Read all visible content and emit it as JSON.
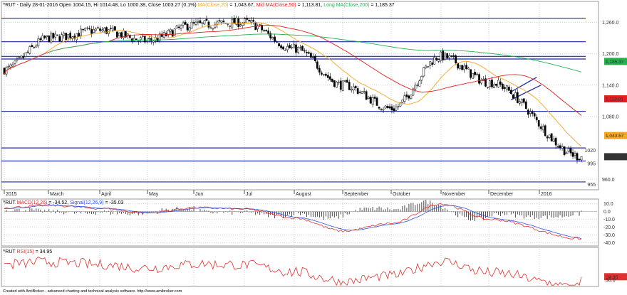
{
  "header": {
    "symbol": "^RUT",
    "info": "- Daily 28-01-2016 Open 1004.15, Hi 1014.48, Lo 1000.38, Close 1003.27 (0.1%)",
    "ma20_label": "MA(Close,20)",
    "ma20_value": "= 1,043.67,",
    "ma50_label": "Mid MA(Close,50)",
    "ma50_value": "= 1,113.81,",
    "ma200_label": "Long MA(Close,200)",
    "ma200_value": "= 1,185.37"
  },
  "macd_header": {
    "symbol": "^RUT",
    "macd_label": "MACD(12,26)",
    "macd_value": "= -34.52,",
    "signal_label": "Signal(12,26,9)",
    "signal_value": "= -35.03"
  },
  "rsi_header": {
    "symbol": "^RUT",
    "rsi_label": "RSI(15)",
    "rsi_value": "= 34.95"
  },
  "footer": "Created with AmiBroker - advanced charting and technical analysis software. http://www.amibroker.com",
  "colors": {
    "ma20": "#f5a623",
    "ma50": "#e02020",
    "ma200": "#22b14c",
    "hline": "#1f2aa8",
    "macd": "#e03030",
    "signal": "#3050e0",
    "rsi": "#e03030",
    "grid": "#cfcfcf"
  },
  "chart_data": [
    {
      "type": "candlestick",
      "title": "^RUT Daily",
      "x": [
        "2015",
        "March",
        "April",
        "May",
        "Jun",
        "Jul",
        "August",
        "September",
        "October",
        "November",
        "December",
        "2016"
      ],
      "y_ticks": [
        1260.0,
        1200.0,
        1140.0,
        1080.0,
        960.0
      ],
      "ylim": [
        940,
        1300
      ],
      "price_waypoints": [
        {
          "x": "2015",
          "close": 1170
        },
        {
          "x": "March",
          "close": 1230
        },
        {
          "x": "April",
          "close": 1245
        },
        {
          "x": "May",
          "close": 1225
        },
        {
          "x": "Jun",
          "close": 1255
        },
        {
          "x": "Jul",
          "close": 1260
        },
        {
          "x": "August",
          "close": 1210
        },
        {
          "x": "September",
          "close": 1140
        },
        {
          "x": "October",
          "close": 1095
        },
        {
          "x": "November",
          "close": 1195
        },
        {
          "x": "December",
          "close": 1145
        },
        {
          "x": "2016",
          "close": 1003.27
        }
      ],
      "horizontal_levels": [
        1268,
        1223,
        1195,
        1190,
        1090,
        1020,
        995,
        955
      ],
      "level_labels": [
        {
          "text": "1020",
          "value": 1020
        },
        {
          "text": "995",
          "value": 995
        },
        {
          "text": "955",
          "value": 955
        }
      ],
      "value_tags": [
        {
          "text": "1,185.37",
          "value": 1185.37,
          "color": "#22b14c"
        },
        {
          "text": "1,113.81",
          "value": 1113.81,
          "color": "#e02020"
        },
        {
          "text": "1,043.67",
          "value": 1043.67,
          "color": "#f5a623"
        },
        {
          "text": "1,003.27",
          "value": 1003.27,
          "color": "#333333"
        }
      ],
      "series": [
        {
          "name": "MA(Close,20)",
          "last": 1043.67
        },
        {
          "name": "Mid MA(Close,50)",
          "last": 1113.81
        },
        {
          "name": "Long MA(Close,200)",
          "last": 1185.37
        }
      ]
    },
    {
      "type": "line",
      "title": "^RUT - MACD(12,26)",
      "y_ticks": [
        10.0,
        0.0,
        -10.0,
        -20.0,
        -30.0,
        -40.0
      ],
      "ylim": [
        -44,
        16
      ],
      "series": [
        {
          "name": "MACD(12,26)",
          "last": -34.52
        },
        {
          "name": "Signal(12,26,9)",
          "last": -35.03
        }
      ],
      "macd_waypoints": [
        {
          "x": "2015",
          "value": 5
        },
        {
          "x": "March",
          "value": 8
        },
        {
          "x": "April",
          "value": 4
        },
        {
          "x": "May",
          "value": -2
        },
        {
          "x": "Jun",
          "value": 5
        },
        {
          "x": "Jul",
          "value": 3
        },
        {
          "x": "August",
          "value": -8
        },
        {
          "x": "September",
          "value": -25
        },
        {
          "x": "October",
          "value": -15
        },
        {
          "x": "November",
          "value": 10
        },
        {
          "x": "December",
          "value": -10
        },
        {
          "x": "2016",
          "value": -35
        }
      ]
    },
    {
      "type": "line",
      "title": "^RUT - RSI(15)",
      "y_ticks": [
        30.0
      ],
      "ylim": [
        20,
        80
      ],
      "series": [
        {
          "name": "RSI(15)",
          "last": 34.95
        }
      ]
    }
  ]
}
